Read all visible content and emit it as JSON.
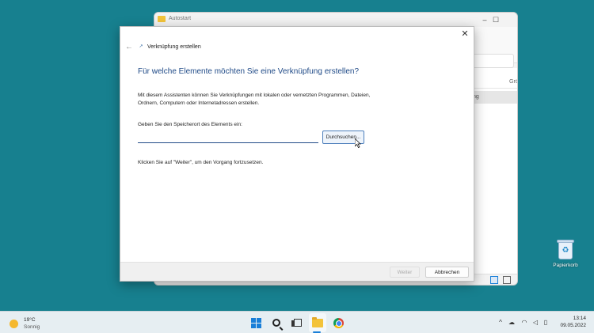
{
  "explorer": {
    "title": "Autostart",
    "column_header": "Grö",
    "selected_row_partial": "ng"
  },
  "dialog": {
    "title": "Verknüpfung erstellen",
    "heading": "Für welche Elemente möchten Sie eine Verknüpfung erstellen?",
    "description": "Mit diesem Assistenten können Sie Verknüpfungen mit lokalen oder vernetzten Programmen, Dateien, Ordnern, Computern oder Internetadressen erstellen.",
    "location_label": "Geben Sie den Speicherort des Elements ein:",
    "location_value": "",
    "browse_label": "Durchsuchen...",
    "hint": "Klicken Sie auf \"Weiter\", um den Vorgang fortzusetzen.",
    "next_label": "Weiter",
    "cancel_label": "Abbrechen"
  },
  "desktop": {
    "recycle_bin_label": "Papierkorb"
  },
  "taskbar": {
    "weather_temp": "19°C",
    "weather_condition": "Sonnig",
    "time": "13:14",
    "date": "09.05.2022",
    "icons": [
      "windows-start",
      "search",
      "task-view",
      "file-explorer",
      "chrome"
    ],
    "tray_icons": [
      "chevron-up",
      "onedrive-cloud",
      "wifi",
      "speaker",
      "battery"
    ]
  },
  "colors": {
    "desktop_bg": "#17808f",
    "heading_blue": "#1f4a87",
    "accent": "#1a7fd8"
  }
}
